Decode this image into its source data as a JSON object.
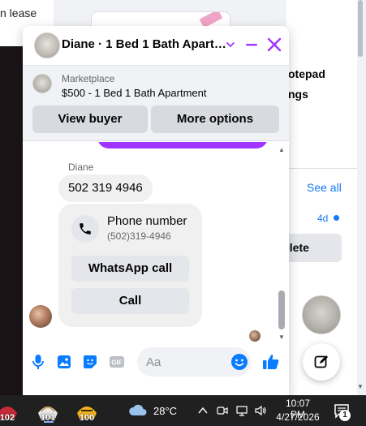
{
  "background": {
    "lease_text": "n lease",
    "notepad_lines": [
      "otepad",
      "ngs"
    ],
    "see_all": "See all",
    "time_ago": "4d",
    "delete_label": "elete"
  },
  "chat": {
    "title": "Diane · 1 Bed 1 Bath Apart…",
    "marketplace": {
      "label": "Marketplace",
      "item": "$500 - 1 Bed 1 Bath Apartment",
      "view_buyer": "View buyer",
      "more_options": "More options"
    },
    "messages": {
      "sender_name": "Diane",
      "phone_message": "502 319 4946",
      "card": {
        "title": "Phone number",
        "number": "(502)319-4946",
        "whatsapp_label": "WhatsApp call",
        "call_label": "Call"
      }
    },
    "composer": {
      "placeholder": "Aa"
    },
    "colors": {
      "accent": "#a033ff",
      "icon_blue": "#0a7cff"
    }
  },
  "taskbar": {
    "apps": [
      {
        "name": "app-1",
        "badge": "102"
      },
      {
        "name": "app-2",
        "badge": "101"
      },
      {
        "name": "app-3",
        "badge": "100"
      }
    ],
    "temperature": "28°C",
    "time": "10:07 PM",
    "date": "4/27/2026",
    "notification_count": "1"
  }
}
